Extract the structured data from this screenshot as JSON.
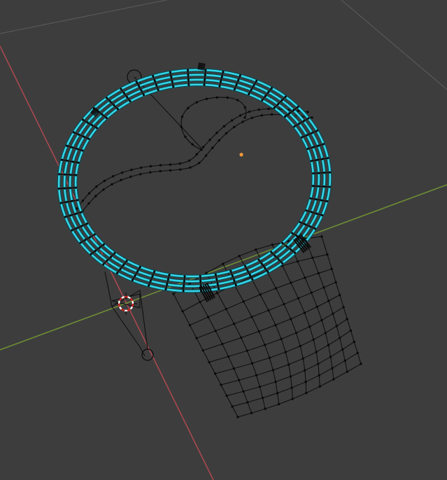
{
  "viewport": {
    "name": "3D Viewport",
    "background_color": "#3d3d3d"
  },
  "colors": {
    "x_axis": "#a9484f",
    "y_axis": "#6e8c35",
    "grid_line": "#5c5c5c",
    "wire": "#0b0b0b",
    "vertex": "#0b0b0b",
    "selected_edge": "#34d6e8",
    "selected_edge_outline": "#0c4850",
    "origin": "#f29b3a",
    "cursor_red": "#d42020",
    "cursor_white": "#ffffff"
  },
  "icons": {
    "cursor": "3d-cursor-icon",
    "origin": "object-origin-icon",
    "empty": "empty-circle-icon"
  }
}
